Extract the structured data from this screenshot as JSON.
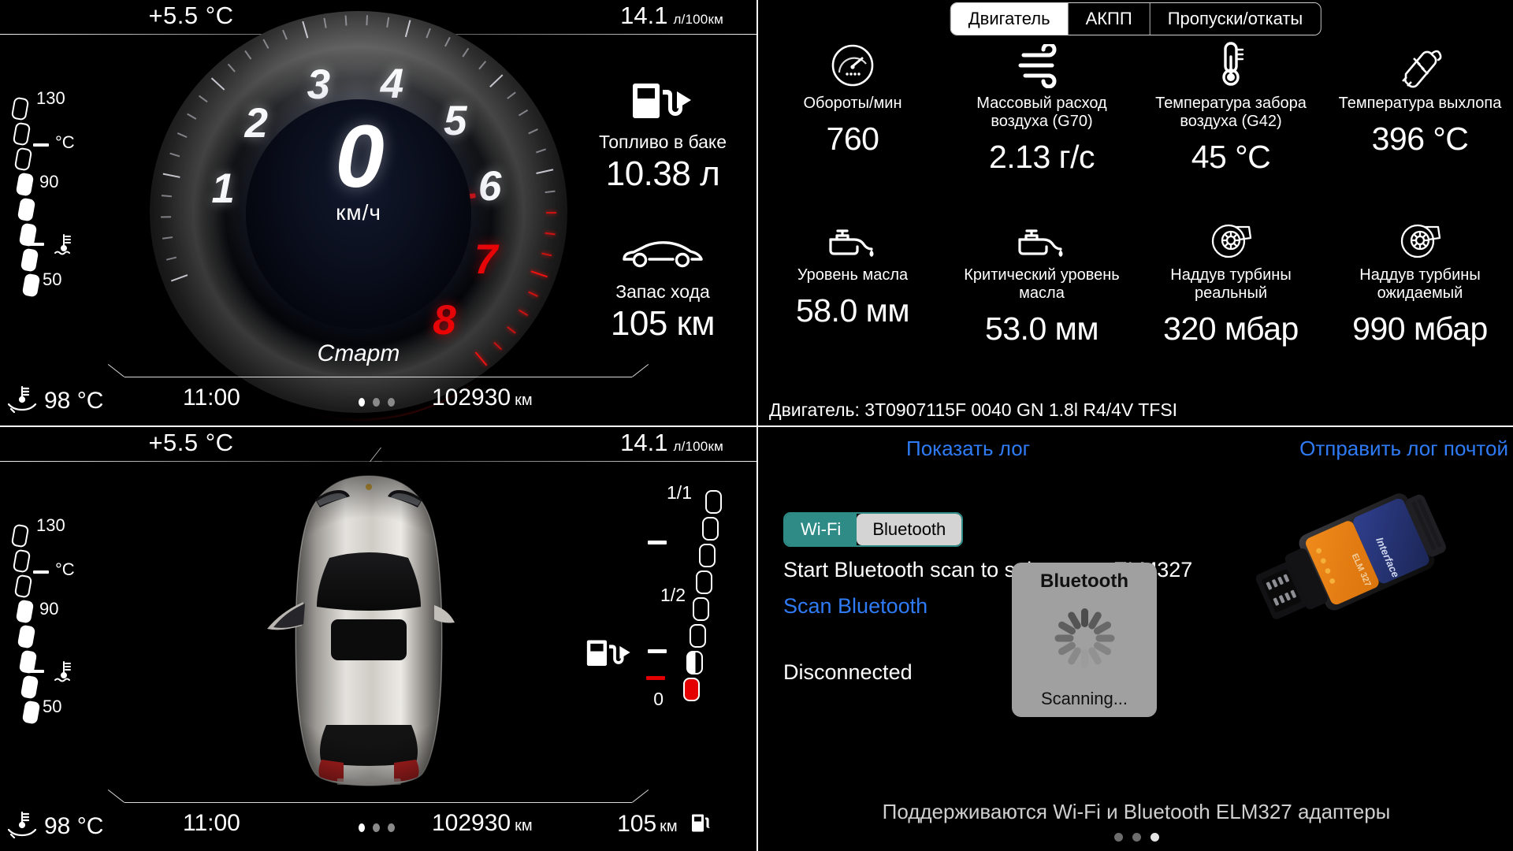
{
  "cluster": {
    "ambient_temp": "+5.5 °C",
    "consumption_value": "14.1",
    "consumption_unit": "л/100км",
    "speed_value": "0",
    "speed_unit": "км/ч",
    "gear_text": "Старт",
    "tach_numbers": [
      "1",
      "2",
      "3",
      "4",
      "5",
      "6",
      "7",
      "8"
    ],
    "coolant_labels": {
      "top": "130",
      "mid": "90",
      "bottom": "50",
      "unit": "°C"
    },
    "fuel_block": {
      "icon": "fuel-pump-icon",
      "label": "Топливо в баке",
      "value": "10.38 л"
    },
    "range_block": {
      "icon": "car-side-icon",
      "label": "Запас хода",
      "value": "105 км"
    },
    "bottom": {
      "oil_icon": "oil-temp-icon",
      "oil_temp": "98 °C",
      "clock": "11:00",
      "odometer": "102930",
      "odometer_unit": "км"
    }
  },
  "cluster_car": {
    "ambient_temp": "+5.5 °C",
    "consumption_value": "14.1",
    "consumption_unit": "л/100км",
    "coolant_labels": {
      "top": "130",
      "mid": "90",
      "bottom": "50",
      "unit": "°C"
    },
    "fuel_labels": {
      "full": "1/1",
      "half": "1/2",
      "empty": "0"
    },
    "bottom": {
      "oil_icon": "oil-temp-icon",
      "oil_temp": "98 °C",
      "clock": "11:00",
      "odometer": "102930",
      "odometer_unit": "км",
      "range": "105",
      "range_unit": "км",
      "fuel_icon": "fuel-pump-icon"
    }
  },
  "obd": {
    "tabs": [
      {
        "label": "Двигатель",
        "active": true
      },
      {
        "label": "АКПП",
        "active": false
      },
      {
        "label": "Пропуски/откаты",
        "active": false
      }
    ],
    "cells": [
      {
        "icon": "tachometer-icon",
        "label": "Обороты/мин",
        "value": "760"
      },
      {
        "icon": "airflow-icon",
        "label": "Массовый расход воздуха (G70)",
        "value": "2.13 г/с"
      },
      {
        "icon": "thermometer-icon",
        "label": "Температура забора воздуха (G42)",
        "value": "45 °C"
      },
      {
        "icon": "muffler-icon",
        "label": "Температура выхлопа",
        "value": "396 °C"
      },
      {
        "icon": "oil-can-icon",
        "label": "Уровень масла",
        "value": "58.0 мм"
      },
      {
        "icon": "oil-can-icon",
        "label": "Критический уровень масла",
        "value": "53.0 мм"
      },
      {
        "icon": "turbo-icon",
        "label": "Наддув турбины реальный",
        "value": "320 мбар"
      },
      {
        "icon": "turbo-icon",
        "label": "Наддув турбины ожидаемый",
        "value": "990 мбар"
      }
    ],
    "engine_info": "Двигатель: 3T0907115F  0040     GN  1.8l R4/4V TFSI"
  },
  "bluetooth": {
    "link_show_log": "Показать лог",
    "link_send_log": "Отправить лог почтой",
    "toggle": [
      {
        "label": "Wi-Fi",
        "selected": false
      },
      {
        "label": "Bluetooth",
        "selected": true
      }
    ],
    "hint": "Start Bluetooth scan to select your ELM327",
    "scan_link": "Scan Bluetooth",
    "status": "Disconnected",
    "dialog": {
      "title": "Bluetooth",
      "status": "Scanning..."
    },
    "footer": "Поддерживаются Wi-Fi и Bluetooth ELM327 адаптеры",
    "device_image": "elm327-obd-dongle"
  },
  "colors": {
    "accent_link": "#2f7bf6",
    "teal": "#2e8b86",
    "redline": "#e40000",
    "needle": "#d40c0c"
  }
}
